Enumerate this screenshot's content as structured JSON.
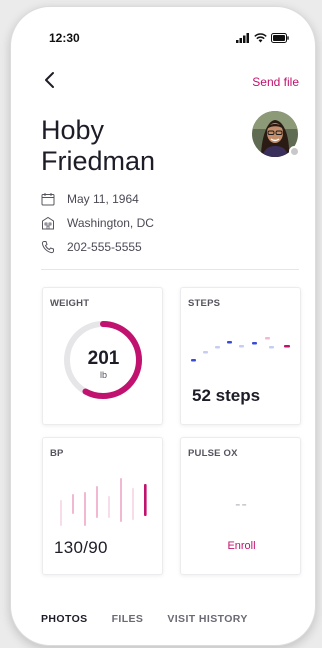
{
  "status_bar": {
    "time": "12:30",
    "icons": [
      "signal-icon",
      "wifi-icon",
      "battery-icon"
    ]
  },
  "nav": {
    "back_icon": "chevron-left-icon",
    "send_file_label": "Send file"
  },
  "patient": {
    "first_name": "Hoby",
    "last_name": "Friedman",
    "dob": "May 11, 1964",
    "location": "Washington, DC",
    "phone": "202-555-5555",
    "status_color": "#c8c8c8"
  },
  "cards": {
    "weight": {
      "title": "WEIGHT",
      "value": "201",
      "unit": "lb",
      "progress_fraction": 0.58,
      "accent": "#c0126e",
      "track": "#e6e6e8"
    },
    "steps": {
      "title": "STEPS",
      "value": "52 steps"
    },
    "bp": {
      "title": "BP",
      "value": "130/90"
    },
    "pulse_ox": {
      "title": "PULSE OX",
      "value": "--",
      "action_label": "Enroll"
    }
  },
  "tabs": [
    {
      "label": "PHOTOS",
      "active": true
    },
    {
      "label": "FILES",
      "active": false
    },
    {
      "label": "VISIT HISTORY",
      "active": false
    }
  ],
  "colors": {
    "accent": "#c0126e",
    "accent_light": "#f2b8d2",
    "blue": "#3b4bd8",
    "blue_light": "#c7ccf3"
  }
}
